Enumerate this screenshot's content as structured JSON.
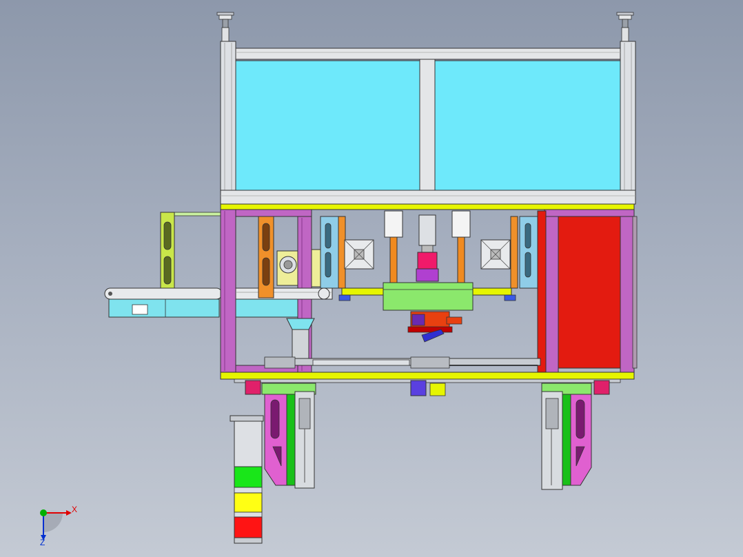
{
  "viewport": {
    "type": "CAD assembly drawing, front view",
    "background": [
      "#8d98ab",
      "#c4cad4"
    ]
  },
  "triad": {
    "x_label": "X",
    "z_label": "Z",
    "x_color": "#e00000",
    "z_color": "#0030d0",
    "origin_color": "#00b000"
  },
  "colors": {
    "frame": "#b0449f",
    "frame_light": "#c77fc0",
    "top_plate": "#e6f500",
    "glass": "#6ee9fb",
    "aluminum": "#dde0e4",
    "red_panel": "#e31b10",
    "green_block": "#8be86c",
    "cyan_bar": "#7fe3ee",
    "orange_bracket": "#f0902a",
    "magenta_bracket": "#e060d0",
    "signal_green": "#19e619",
    "signal_yellow": "#ffff14",
    "signal_red": "#ff1414"
  },
  "signal_tower": {
    "lights": [
      "green",
      "yellow",
      "red"
    ]
  }
}
